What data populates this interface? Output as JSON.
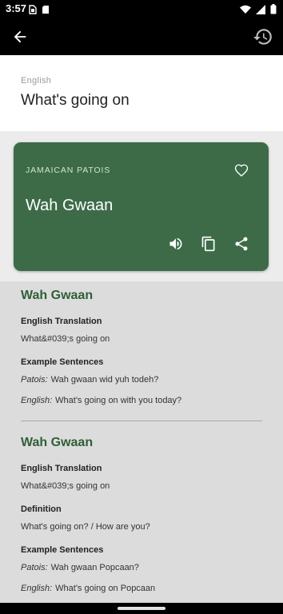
{
  "status_bar": {
    "time": "3:57",
    "left_icons": [
      "sim-card-icon",
      "sd-card-icon"
    ],
    "right_icons": [
      "wifi-icon",
      "signal-icon",
      "battery-icon"
    ]
  },
  "app_bar": {
    "back_icon": "arrow-back-icon",
    "history_icon": "history-icon"
  },
  "source": {
    "language": "English",
    "text": "What's going on"
  },
  "result": {
    "language": "JAMAICAN PATOIS",
    "text": "Wah Gwaan",
    "card_color": "#3d6b48",
    "actions": [
      "favorite-icon",
      "speaker-icon",
      "copy-icon",
      "share-icon"
    ]
  },
  "entries": [
    {
      "title": "Wah Gwaan",
      "translation_label": "English Translation",
      "translation": "What&#039;s going on",
      "examples_label": "Example Sentences",
      "examples": [
        {
          "prefix": "Patois:",
          "text": "Wah gwaan wid yuh todeh?"
        },
        {
          "prefix": "English:",
          "text": "What's going on with you today?"
        }
      ]
    },
    {
      "title": "Wah Gwaan",
      "translation_label": "English Translation",
      "translation": "What&#039;s going on",
      "definition_label": "Definition",
      "definition": "What's going on? / How are you?",
      "examples_label": "Example Sentences",
      "examples": [
        {
          "prefix": "Patois:",
          "text": "Wah gwaan Popcaan?"
        },
        {
          "prefix": "English:",
          "text": "What's going on Popcaan"
        }
      ]
    }
  ],
  "colors": {
    "accent_green": "#2f5f37",
    "app_bar": "#000000"
  }
}
